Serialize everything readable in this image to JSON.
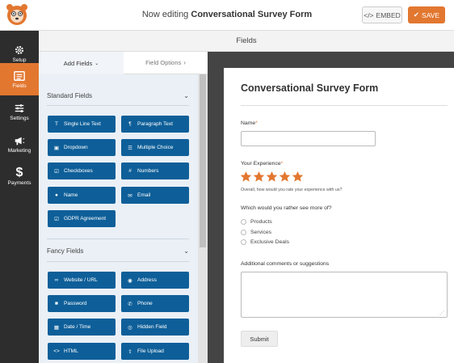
{
  "header": {
    "title_prefix": "Now editing",
    "form_name": "Conversational Survey Form",
    "embed_label": "EMBED",
    "save_label": "SAVE",
    "accent": "#e27730"
  },
  "nav": {
    "items": [
      {
        "label": "Setup",
        "icon": "gear-icon",
        "active": false
      },
      {
        "label": "Fields",
        "icon": "fields-icon",
        "active": true
      },
      {
        "label": "Settings",
        "icon": "sliders-icon",
        "active": false
      },
      {
        "label": "Marketing",
        "icon": "megaphone-icon",
        "active": false
      },
      {
        "label": "Payments",
        "icon": "dollar-icon",
        "active": false
      }
    ]
  },
  "fields_header": "Fields",
  "tabs": {
    "add_fields": "Add Fields",
    "field_options": "Field Options"
  },
  "standard": {
    "title": "Standard Fields",
    "buttons": [
      {
        "label": "Single Line Text",
        "icon": "text-icon"
      },
      {
        "label": "Paragraph Text",
        "icon": "paragraph-icon"
      },
      {
        "label": "Dropdown",
        "icon": "dropdown-icon"
      },
      {
        "label": "Multiple Choice",
        "icon": "list-icon"
      },
      {
        "label": "Checkboxes",
        "icon": "checkbox-icon"
      },
      {
        "label": "Numbers",
        "icon": "hash-icon"
      },
      {
        "label": "Name",
        "icon": "user-icon"
      },
      {
        "label": "Email",
        "icon": "envelope-icon"
      },
      {
        "label": "GDPR Agreement",
        "icon": "checkbox-icon"
      }
    ]
  },
  "fancy": {
    "title": "Fancy Fields",
    "buttons": [
      {
        "label": "Website / URL",
        "icon": "link-icon"
      },
      {
        "label": "Address",
        "icon": "map-pin-icon"
      },
      {
        "label": "Password",
        "icon": "lock-icon"
      },
      {
        "label": "Phone",
        "icon": "phone-icon"
      },
      {
        "label": "Date / Time",
        "icon": "calendar-icon"
      },
      {
        "label": "Hidden Field",
        "icon": "eye-slash-icon"
      },
      {
        "label": "HTML",
        "icon": "code-icon"
      },
      {
        "label": "File Upload",
        "icon": "upload-icon"
      }
    ]
  },
  "form": {
    "title": "Conversational Survey Form",
    "name_label": "Name",
    "experience_label": "Your Experience",
    "rating_value": 5,
    "rating_max": 5,
    "experience_sub": "Overall, how would you rate your experience with us?",
    "more_label": "Which would you rather see more of?",
    "options": [
      "Products",
      "Services",
      "Exclusive Deals"
    ],
    "comments_label": "Additional comments or suggestions",
    "submit_label": "Submit",
    "required_mark": "*"
  }
}
